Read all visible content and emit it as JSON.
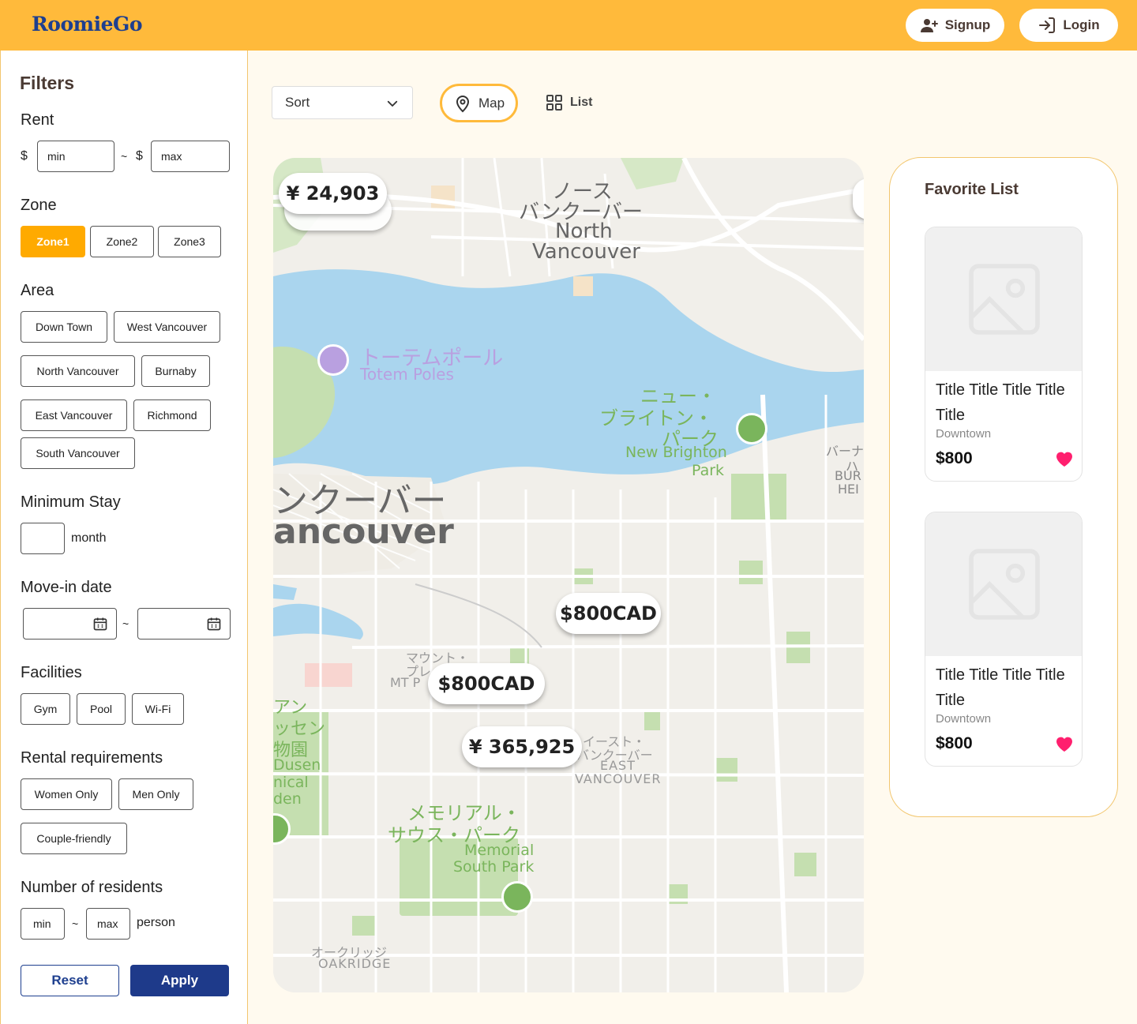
{
  "header": {
    "logo": "RoomieGo",
    "signup_label": "Signup",
    "login_label": "Login",
    "brand_color": "#ffba3b"
  },
  "filters": {
    "title": "Filters",
    "rent": {
      "label": "Rent",
      "currency": "$",
      "min_placeholder": "min",
      "max_placeholder": "max",
      "separator": "~"
    },
    "zone": {
      "label": "Zone",
      "options": [
        "Zone1",
        "Zone2",
        "Zone3"
      ],
      "selected": "Zone1"
    },
    "area": {
      "label": "Area",
      "options": [
        "Down Town",
        "West Vancouver",
        "North Vancouver",
        "Burnaby",
        "East Vancouver",
        "Richmond",
        "South Vancouver"
      ]
    },
    "minimum_stay": {
      "label": "Minimum Stay",
      "unit": "month"
    },
    "move_in": {
      "label": "Move-in date",
      "separator": "~"
    },
    "facilities": {
      "label": "Facilities",
      "options": [
        "Gym",
        "Pool",
        "Wi-Fi"
      ]
    },
    "rental_requirements": {
      "label": "Rental requirements",
      "options": [
        "Women Only",
        "Men Only",
        "Couple-friendly"
      ]
    },
    "residents": {
      "label": "Number of residents",
      "min_placeholder": "min",
      "max_placeholder": "max",
      "separator": "~",
      "unit": "person"
    },
    "reset_label": "Reset",
    "apply_label": "Apply"
  },
  "toolbar": {
    "sort_label": "Sort",
    "map_label": "Map",
    "list_label": "List"
  },
  "map": {
    "labels": {
      "north_van_jp1": "ノース",
      "north_van_jp2": "バンクーバー",
      "north_van_en1": "North",
      "north_van_en2": "Vancouver",
      "totem_jp": "トーテムポール",
      "totem_en": "Totem Poles",
      "nb_jp1": "ニュー・",
      "nb_jp2": "ブライトン・",
      "nb_jp3": "パーク",
      "nb_en1": "New Brighton",
      "nb_en2": "Park",
      "van_jp": "ンクーバー",
      "van_en": "ancouver",
      "burnaby_jp": "バーナ",
      "burnaby_jp2": "ハ",
      "burnaby_en": "BUR",
      "burnaby_en2": "HEI",
      "mtp_jp1": "マウント・",
      "mtp_jp2": "プレ",
      "mtp_en": "MT P",
      "garden_jp1": "アン",
      "garden_jp2": "ッセン",
      "garden_jp3": "物園",
      "garden_en1": "Dusen",
      "garden_en2": "nical",
      "garden_en3": "den",
      "ev_jp1": "イースト・",
      "ev_jp2": "バンクーバー",
      "ev_en1": "EAST",
      "ev_en2": "VANCOUVER",
      "msp_jp1": "メモリアル・",
      "msp_jp2": "サウス・パーク",
      "msp_en1": "Memorial",
      "msp_en2": "South Park",
      "oak_jp": "オークリッジ",
      "oak_en": "OAKRIDGE"
    },
    "price_pins": [
      "¥ 24,903",
      "$800CAD",
      "$800CAD",
      "¥ 365,925"
    ]
  },
  "favorites": {
    "title": "Favorite List",
    "items": [
      {
        "title": "Title Title Title Title Title",
        "area": "Downtown",
        "price": "$800"
      },
      {
        "title": "Title Title Title Title Title",
        "area": "Downtown",
        "price": "$800"
      }
    ],
    "heart_color": "#ff1f6e"
  }
}
